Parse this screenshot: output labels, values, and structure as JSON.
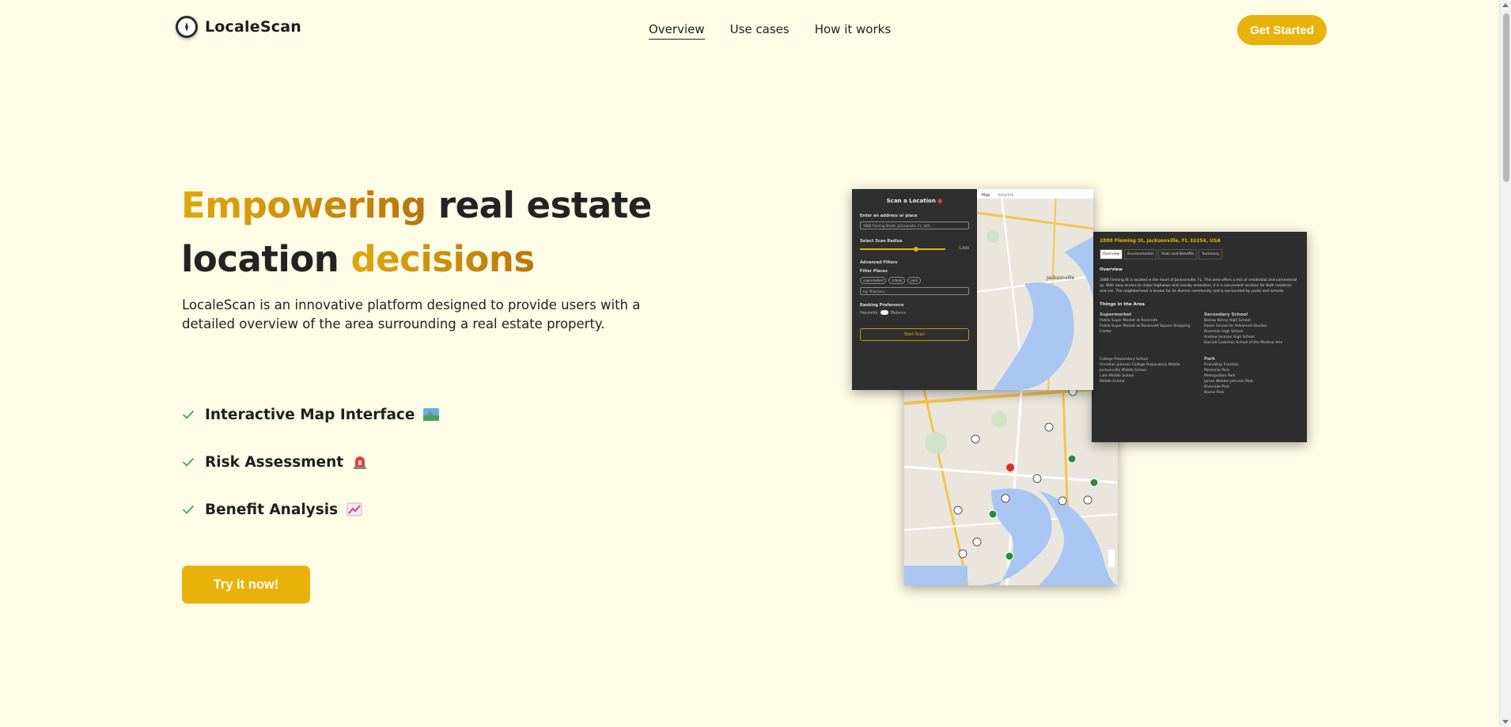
{
  "brand": {
    "name": "LocaleScan"
  },
  "nav": {
    "items": [
      {
        "label": "Overview",
        "active": true
      },
      {
        "label": "Use cases",
        "active": false
      },
      {
        "label": "How it works",
        "active": false
      }
    ],
    "cta_label": "Get Started"
  },
  "hero": {
    "title_part1": "Empowering",
    "title_part2": " real estate",
    "title_part3": "location ",
    "title_part4": "decisions",
    "description": "LocaleScan is an innovative platform designed to provide users with a detailed overview of the area surrounding a real estate property.",
    "features": [
      {
        "label": "Interactive Map Interface",
        "icon": "map-emoji-icon"
      },
      {
        "label": "Risk Assessment",
        "icon": "siren-emoji-icon"
      },
      {
        "label": "Benefit Analysis",
        "icon": "chart-increasing-emoji-icon"
      }
    ],
    "try_label": "Try it now!"
  },
  "preview": {
    "scan": {
      "title": "Scan a Location",
      "address_label": "Enter an address or place",
      "address_value": "2888 Fleming Street, Jacksonville, FL, USA",
      "radius_label": "Select Scan Radius",
      "radius_value": "5,000",
      "advanced_label": "Advanced Filters",
      "filter_label": "Filter Places",
      "chips": [
        "supermarket",
        "school",
        "park"
      ],
      "filter_placeholder": "Eg: Pharmacy",
      "ranking_label": "Ranking Preference",
      "ranking_left": "Popularity",
      "ranking_right": "Distance",
      "start_label": "Start Scan",
      "map_tabs": [
        "Map",
        "Satellite"
      ],
      "map_city": "Jacksonville"
    },
    "details": {
      "title": "2888 Fleming St, Jacksonville, FL 32254, USA",
      "tabs": [
        "Overview",
        "Environmental",
        "Risks and Benefits",
        "Summary"
      ],
      "overview_heading": "Overview",
      "overview_text": "2888 Fleming St is located in the heart of Jacksonville, FL. This area offers a mix of residential and commercial sp. With easy access to major highways and nearby amenities, it is a convenient location for both residents and visi. The neighborhood is known for its diverse community and is surrounded by parks and schools.",
      "things_heading": "Things in the Area",
      "col1_heading": "Supermarket",
      "col1_items": [
        "Publix Super Market at Riverside",
        "Publix Super Market at Roosevelt Square Shopping Center"
      ],
      "col2_heading": "Secondary School",
      "col2_items": [
        "Bishop Kenny High School",
        "Paxon School for Advanced Studies",
        "Riverside High School",
        "Andrew Jackson High School",
        "Darnell-Cookman School of the Medical Arts"
      ],
      "col3_items": [
        "College Preparatory School",
        "Christian Johnson College Preparatory Middle",
        "Jacksonville Middle School",
        "Lake Middle School",
        "Middle School"
      ],
      "col4_heading": "Park",
      "col4_items": [
        "Friendship Fountain",
        "Memorial Park",
        "Metropolitan Park",
        "James Weldon Johnson Park",
        "Riverside Park",
        "Boone Park"
      ]
    },
    "map": {
      "city": "Jacksonville"
    }
  },
  "colors": {
    "accent": "#e9b20a",
    "background": "#fefbe6",
    "dark_panel": "#2e2e2e",
    "check": "#3aa76d"
  }
}
